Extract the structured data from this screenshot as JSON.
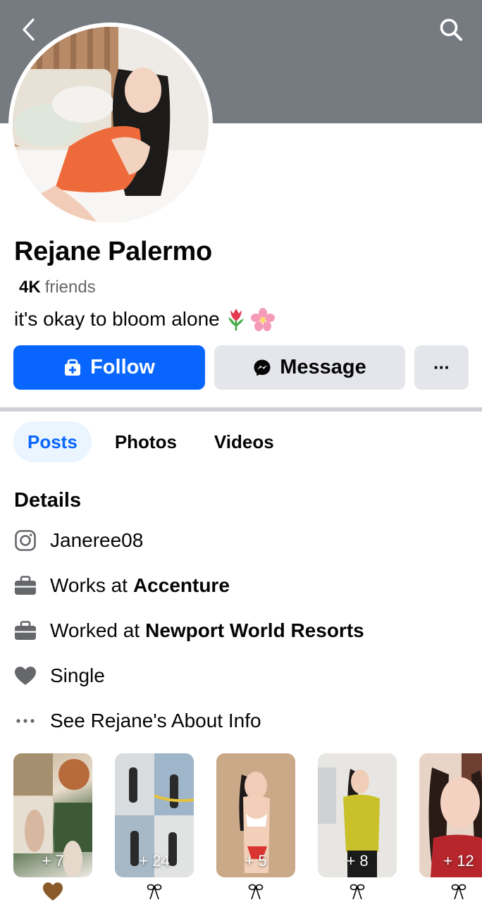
{
  "profile": {
    "name": "Rejane Palermo",
    "friends_count": "4K",
    "friends_label": "friends",
    "bio": "it's okay to bloom alone"
  },
  "actions": {
    "follow_label": "Follow",
    "message_label": "Message",
    "more_label": "···"
  },
  "tabs": [
    {
      "label": "Posts",
      "active": true
    },
    {
      "label": "Photos",
      "active": false
    },
    {
      "label": "Videos",
      "active": false
    }
  ],
  "details": {
    "title": "Details",
    "instagram": "Janeree08",
    "work_prefix": "Works at",
    "work_place": "Accenture",
    "past_work_prefix": "Worked at",
    "past_work_place": "Newport World Resorts",
    "relationship": "Single",
    "about_link": "See Rejane's About Info"
  },
  "stories": [
    {
      "count": "+ 7"
    },
    {
      "count": "+ 24"
    },
    {
      "count": "+ 5"
    },
    {
      "count": "+ 8"
    },
    {
      "count": "+ 12"
    }
  ],
  "icons": {
    "back": "chevron-left-icon",
    "search": "search-icon",
    "bio_emoji": [
      "tulip-icon",
      "cherry-blossom-icon"
    ],
    "follow": "add-friend-icon",
    "message": "messenger-icon",
    "instagram": "instagram-icon",
    "work": "briefcase-icon",
    "relationship": "heart-icon",
    "about": "more-dots-icon",
    "story_badges": [
      "brown-heart-icon",
      "ribbon-icon",
      "ribbon-icon",
      "ribbon-icon",
      "ribbon-icon"
    ]
  },
  "colors": {
    "cover": "#767b82",
    "primary": "#0866ff",
    "secondary_button": "#e4e6eb",
    "tab_active_bg": "#ebf5ff",
    "muted_text": "#65676b"
  }
}
